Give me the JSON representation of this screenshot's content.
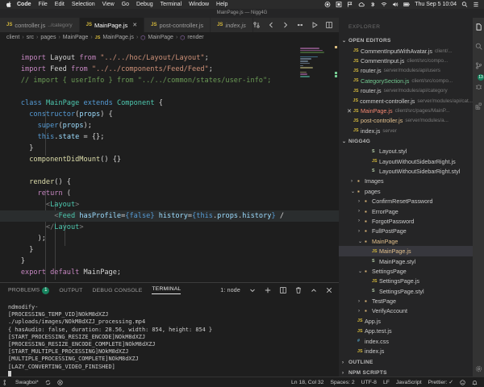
{
  "menubar": {
    "app": "Code",
    "items": [
      "File",
      "Edit",
      "Selection",
      "View",
      "Go",
      "Debug",
      "Terminal",
      "Window",
      "Help"
    ],
    "clock": "Thu Sep 5  10:04"
  },
  "window": {
    "title": "MainPage.js — Nigg4G"
  },
  "tabs": [
    {
      "label": "controller.js",
      "desc": "../category",
      "active": false,
      "italic": false
    },
    {
      "label": "MainPage.js",
      "desc": "",
      "active": true,
      "italic": false
    },
    {
      "label": "post-controller.js",
      "desc": "",
      "active": false,
      "italic": false
    },
    {
      "label": "index.js",
      "desc": "",
      "active": false,
      "italic": true
    }
  ],
  "breadcrumb": [
    "client",
    "src",
    "pages",
    "MainPage",
    "MainPage.js",
    "MainPage",
    "render"
  ],
  "terminal": {
    "tab_problems": "PROBLEMS",
    "problems_count": "1",
    "tab_output": "OUTPUT",
    "tab_debug": "DEBUG CONSOLE",
    "tab_terminal": "TERMINAL",
    "selector": "1: node",
    "lines": [
      "ndmodify-",
      "[PROCESSING_TEMP_VID]NOkM8dXZJ",
      "./uploads/images/NOkM8dXZJ_processing.mp4",
      "{ hasAudio: false, duration: 28.56, width: 854, height: 854 }",
      "[START_PROCESSING_RESIZE_ENCODE]NOkM8dXZJ",
      "[PROCESSING_RESIZE_ENCODE_COMPLETE]NOkM8dXZJ",
      "[START_MULTIPLE_PROCESSING]NOkM8dXZJ",
      "[MULTIPLE_PROCESSING_COMPLETE]NOkM8dXZJ",
      "[LAZY_CONVERTING_VIDEO_FINISHED]"
    ]
  },
  "explorer": {
    "header": "EXPLORER",
    "open_editors_label": "OPEN EDITORS",
    "open_editors": [
      {
        "name": "CommentInputWithAvatar.js",
        "path": "client/...",
        "state": "normal",
        "close": false
      },
      {
        "name": "CommentInput.js",
        "path": "client/src/compo...",
        "state": "normal",
        "close": false
      },
      {
        "name": "router.js",
        "path": "server/modules/api/users",
        "state": "normal",
        "close": false
      },
      {
        "name": "CategorySection.js",
        "path": "client/src/compo...",
        "state": "add",
        "close": false
      },
      {
        "name": "router.js",
        "path": "server/modules/api/category",
        "state": "normal",
        "close": false
      },
      {
        "name": "comment-controller.js",
        "path": "server/modules/api/cat...",
        "state": "normal",
        "close": false
      },
      {
        "name": "MainPage.js",
        "path": "client/src/pages/MainP...",
        "state": "del",
        "close": true
      },
      {
        "name": "post-controller.js",
        "path": "server/modules/a...",
        "state": "mod",
        "close": false
      },
      {
        "name": "index.js",
        "path": "server",
        "state": "normal",
        "close": false
      }
    ],
    "project_label": "NIGG4G",
    "tree": [
      {
        "name": "Layout.styl",
        "type": "styl",
        "depth": 3,
        "arrow": ""
      },
      {
        "name": "LayoutWithoutSidebarRight.js",
        "type": "js",
        "depth": 3,
        "arrow": ""
      },
      {
        "name": "LayoutWithoutSidebarRight.styl",
        "type": "styl",
        "depth": 3,
        "arrow": ""
      },
      {
        "name": "Images",
        "type": "folder",
        "depth": 1,
        "arrow": "›"
      },
      {
        "name": "pages",
        "type": "folder",
        "depth": 1,
        "arrow": "⌄"
      },
      {
        "name": "ConfirmResetPassword",
        "type": "folder",
        "depth": 2,
        "arrow": "›"
      },
      {
        "name": "ErrorPage",
        "type": "folder",
        "depth": 2,
        "arrow": "›"
      },
      {
        "name": "ForgotPassword",
        "type": "folder",
        "depth": 2,
        "arrow": "›"
      },
      {
        "name": "FullPostPage",
        "type": "folder",
        "depth": 2,
        "arrow": "›"
      },
      {
        "name": "MainPage",
        "type": "folder",
        "depth": 2,
        "arrow": "⌄",
        "mod": true
      },
      {
        "name": "MainPage.js",
        "type": "js",
        "depth": 3,
        "arrow": "",
        "selected": true,
        "mod": true
      },
      {
        "name": "MainPage.styl",
        "type": "styl",
        "depth": 3,
        "arrow": ""
      },
      {
        "name": "SettingsPage",
        "type": "folder",
        "depth": 2,
        "arrow": "⌄"
      },
      {
        "name": "SettingsPage.js",
        "type": "js",
        "depth": 3,
        "arrow": ""
      },
      {
        "name": "SettingsPage.styl",
        "type": "styl",
        "depth": 3,
        "arrow": ""
      },
      {
        "name": "TestPage",
        "type": "folder",
        "depth": 2,
        "arrow": "›"
      },
      {
        "name": "VerifyAccount",
        "type": "folder",
        "depth": 2,
        "arrow": "›"
      },
      {
        "name": "App.js",
        "type": "js",
        "depth": 1,
        "arrow": ""
      },
      {
        "name": "App.test.js",
        "type": "js",
        "depth": 1,
        "arrow": ""
      },
      {
        "name": "index.css",
        "type": "css",
        "depth": 1,
        "arrow": ""
      },
      {
        "name": "index.js",
        "type": "js",
        "depth": 1,
        "arrow": ""
      }
    ],
    "outline_label": "OUTLINE",
    "npm_label": "NPM SCRIPTS"
  },
  "statusbar": {
    "branch": "Swagboi*",
    "position": "Ln 18, Col 32",
    "spaces": "Spaces: 2",
    "encoding": "UTF-8",
    "eol": "LF",
    "language": "JavaScript",
    "prettier": "Prettier: ✓"
  },
  "colors": {
    "editor_bg": "#1e1e1e",
    "sidebar_bg": "#252526",
    "accent_green": "#16825d",
    "keyword": "#c586c0",
    "string": "#ce9178",
    "class": "#4ec9b0",
    "function": "#dcdcaa",
    "variable": "#9cdcfe",
    "comment": "#6a9955"
  }
}
